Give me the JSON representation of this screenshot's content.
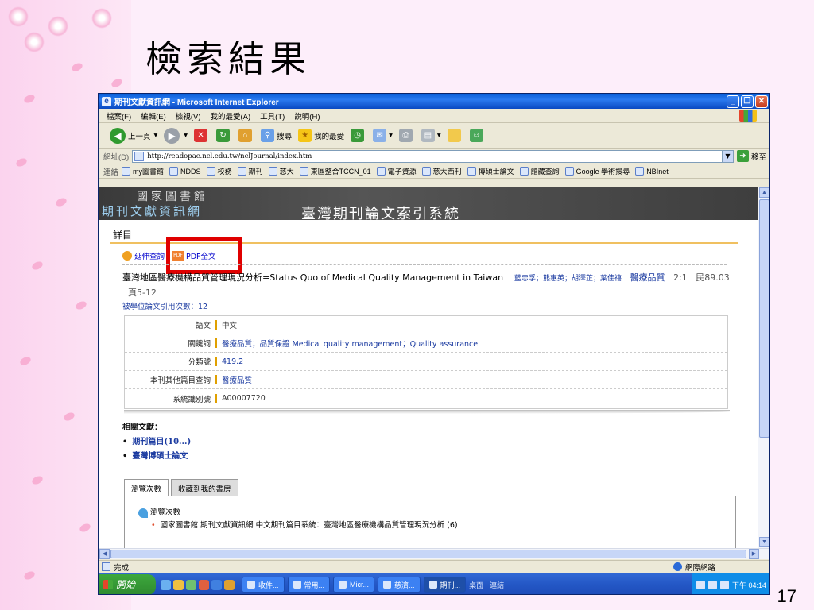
{
  "slide": {
    "title": "檢索結果",
    "page_number": "17"
  },
  "window": {
    "title": "期刊文獻資訊網 - Microsoft Internet Explorer",
    "menu": [
      "檔案(F)",
      "編輯(E)",
      "檢視(V)",
      "我的最愛(A)",
      "工具(T)",
      "說明(H)"
    ],
    "toolbar": {
      "back_label": "上一頁",
      "search_label": "搜尋",
      "favorites_label": "我的最愛"
    },
    "address": {
      "label": "網址(D)",
      "url": "http://readopac.ncl.edu.tw/nclJournal/index.htm",
      "go_label": "移至"
    },
    "links": {
      "label": "連結",
      "items": [
        "my圖書館",
        "NDDS",
        "校務",
        "期刊",
        "慈大",
        "東區整合TCCN_01",
        "電子資源",
        "慈大西刊",
        "博碩士論文",
        "館藏查詢",
        "Google 學術搜尋",
        "NBInet"
      ]
    },
    "status": {
      "text": "完成",
      "zone": "網際網路"
    }
  },
  "page": {
    "banner": {
      "library": "國家圖書館",
      "system": "期刊文獻資訊網",
      "main_title": "臺灣期刊論文索引系統"
    },
    "section_title": "詳目",
    "actions": {
      "extend": "延伸查詢",
      "pdf": "PDF全文"
    },
    "article": {
      "title": "臺灣地區醫療機構品質管理現況分析=Status Quo of Medical Quality Management in Taiwan",
      "authors": "藍忠孚；熊惠英；胡澤芷；葉佳禧",
      "journal": "醫療品質",
      "volume": "2:1",
      "date": "民89.03",
      "pages": "頁5-12",
      "cited": "被學位論文引用次數：12"
    },
    "details": [
      {
        "label": "語文",
        "value": "中文",
        "link": false
      },
      {
        "label": "關鍵詞",
        "value": "醫療品質；品質保證 Medical quality management；Quality assurance",
        "link": true
      },
      {
        "label": "分類號",
        "value": "419.2",
        "link": true
      },
      {
        "label": "本刊其他篇目查詢",
        "value": "醫療品質",
        "link": true
      },
      {
        "label": "系統識別號",
        "value": "A00007720",
        "link": false
      }
    ],
    "related": {
      "heading": "相關文獻：",
      "items": [
        "期刊篇目(10...)",
        "臺灣博碩士論文"
      ]
    },
    "tabs": [
      "瀏覽次數",
      "收藏到我的書房"
    ],
    "stats": {
      "heading": "瀏覽次數",
      "row": "國家圖書館 期刊文獻資訊網 中文期刊篇目系統：臺灣地區醫療機構品質管理現況分析 (6)"
    }
  },
  "taskbar": {
    "start": "開始",
    "tasks": [
      "收件...",
      "常用...",
      "Micr...",
      "慈濟...",
      "期刊..."
    ],
    "desktop": "桌面",
    "links": "連結",
    "clock": "下午 04:14"
  }
}
